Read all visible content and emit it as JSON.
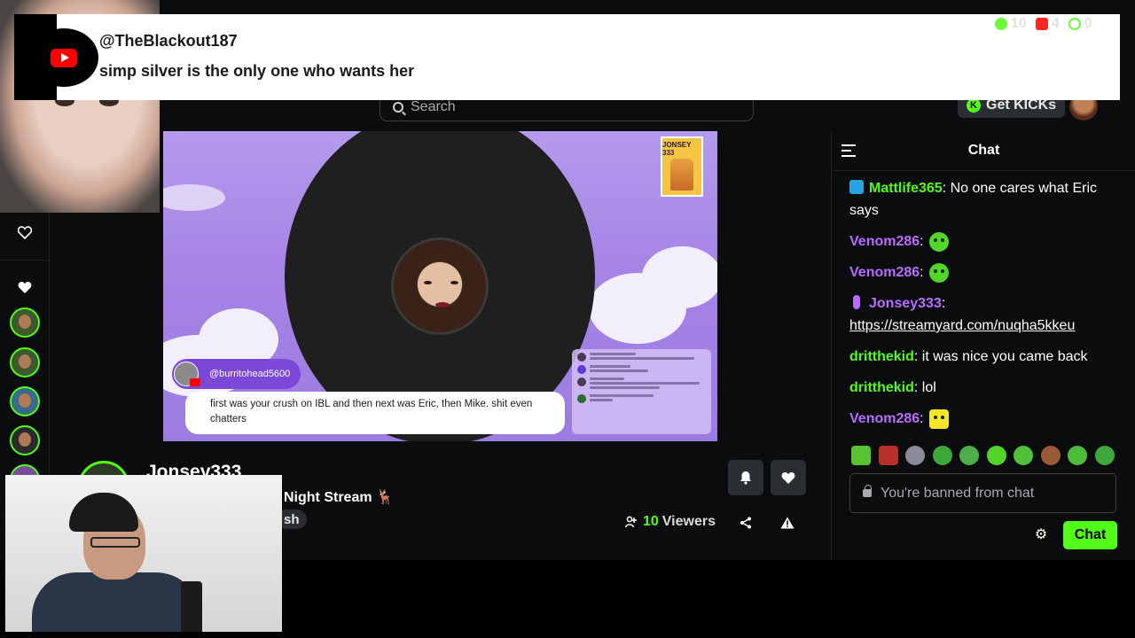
{
  "youtube_alert": {
    "username": "@TheBlackout187",
    "message": "simp silver is the only one who wants her"
  },
  "stream_stats": {
    "kick_viewers": "10",
    "youtube_viewers": "4",
    "other_viewers": "0",
    "kick_color": "#53fc18",
    "youtube_color": "#ff0000"
  },
  "search": {
    "placeholder": "Search"
  },
  "header": {
    "get_kicks_label": "Get KICKs"
  },
  "video_overlay": {
    "badge_text": "JONSEY 333",
    "comment_author": "@burritohead5600",
    "comment_text": "first was your crush on IBL and then next was Eric, then Mike. shit even chatters"
  },
  "channel": {
    "name": "Jonsey333",
    "stream_title": "Night Stream 🦌",
    "tag": "sh",
    "viewers_count": "10",
    "viewers_label": "Viewers"
  },
  "chat": {
    "title": "Chat",
    "messages": [
      {
        "user": "Mattlife365",
        "color": "#53fc18",
        "text": "No one cares what Eric says"
      },
      {
        "user": "Venom286",
        "color": "#b76cfd",
        "text": ""
      },
      {
        "user": "Venom286",
        "color": "#b76cfd",
        "text": ""
      },
      {
        "user": "Jonsey333",
        "color": "#b76cfd",
        "text": "https://streamyard.com/nuqha5kkeu"
      },
      {
        "user": "dritthekid",
        "color": "#53fc18",
        "text": "it was nice you came back"
      },
      {
        "user": "dritthekid",
        "color": "#53fc18",
        "text": "lol"
      },
      {
        "user": "Venom286",
        "color": "#b76cfd",
        "text": ""
      }
    ],
    "input_placeholder": "You're banned from chat",
    "send_label": "Chat"
  },
  "icons": {
    "sidebar": [
      "heart-outline-icon",
      "heart-icon"
    ],
    "actions": [
      "bell-icon",
      "heart-icon",
      "share-icon",
      "warning-icon",
      "gear-icon"
    ]
  }
}
